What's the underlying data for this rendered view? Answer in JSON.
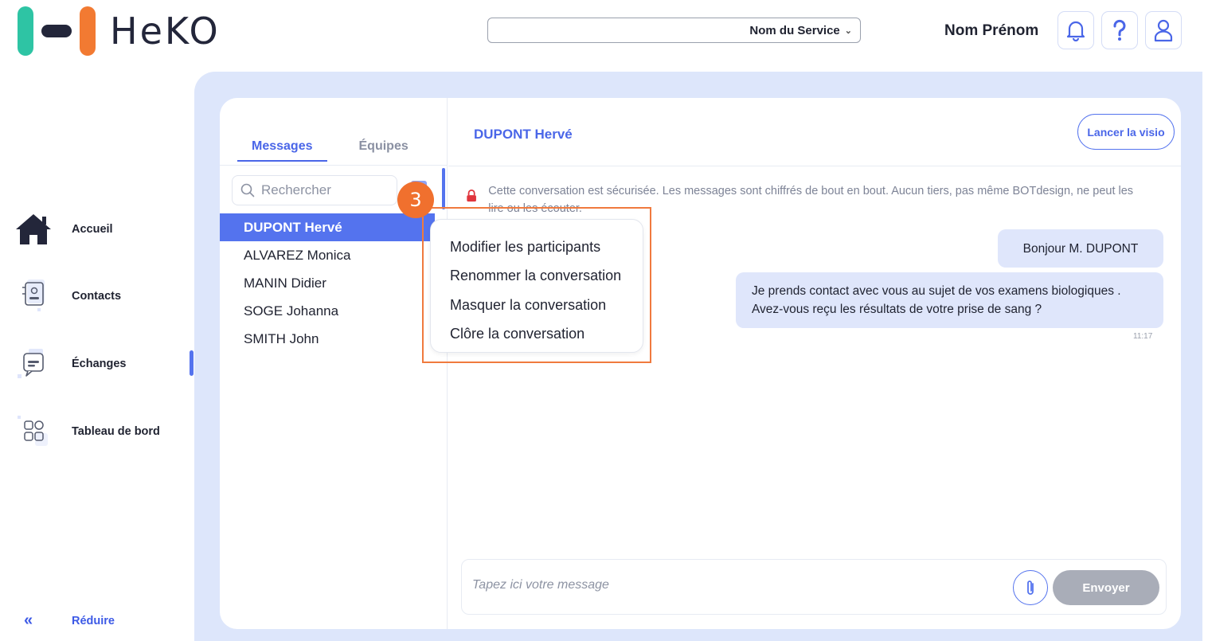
{
  "app": {
    "brand": "HeKO"
  },
  "header": {
    "service_select": "Nom du Service",
    "user_name": "Nom Prénom",
    "icons": [
      "bell-icon",
      "help-icon",
      "user-icon"
    ]
  },
  "sidebar": {
    "items": [
      {
        "label": "Accueil",
        "icon": "home-icon"
      },
      {
        "label": "Contacts",
        "icon": "contacts-icon"
      },
      {
        "label": "Échanges",
        "icon": "chat-icon"
      },
      {
        "label": "Tableau de bord",
        "icon": "dashboard-icon"
      }
    ],
    "active": "Échanges",
    "reduce_label": "Réduire"
  },
  "conversations": {
    "tabs": [
      "Messages",
      "Équipes"
    ],
    "active_tab": "Messages",
    "search_placeholder": "Rechercher",
    "contacts": [
      "DUPONT Hervé",
      "ALVAREZ Monica",
      "MANIN Didier",
      "SOGE Johanna",
      "SMITH John"
    ],
    "selected": "DUPONT Hervé"
  },
  "chat": {
    "title": "DUPONT Hervé",
    "visio_button": "Lancer la visio",
    "security_notice": "Cette conversation est sécurisée. Les messages sont chiffrés de bout en bout. Aucun tiers, pas même BOTdesign, ne peut les lire ou les écouter.",
    "messages": [
      {
        "text": "Bonjour M. DUPONT"
      },
      {
        "text": "Je prends contact avec vous au sujet de vos examens biologiques . Avez-vous reçu les résultats de votre prise de sang ?"
      }
    ],
    "time": "11:17",
    "compose_placeholder": "Tapez ici votre message",
    "send_button": "Envoyer"
  },
  "context_menu": {
    "items": [
      "Modifier les participants",
      "Renommer la conversation",
      "Masquer la conversation",
      "Clôre la conversation"
    ]
  },
  "annotation": {
    "step": "3"
  },
  "colors": {
    "accent": "#5473ee",
    "highlight": "#f07a3e",
    "bg_panel": "#dde6fb"
  }
}
